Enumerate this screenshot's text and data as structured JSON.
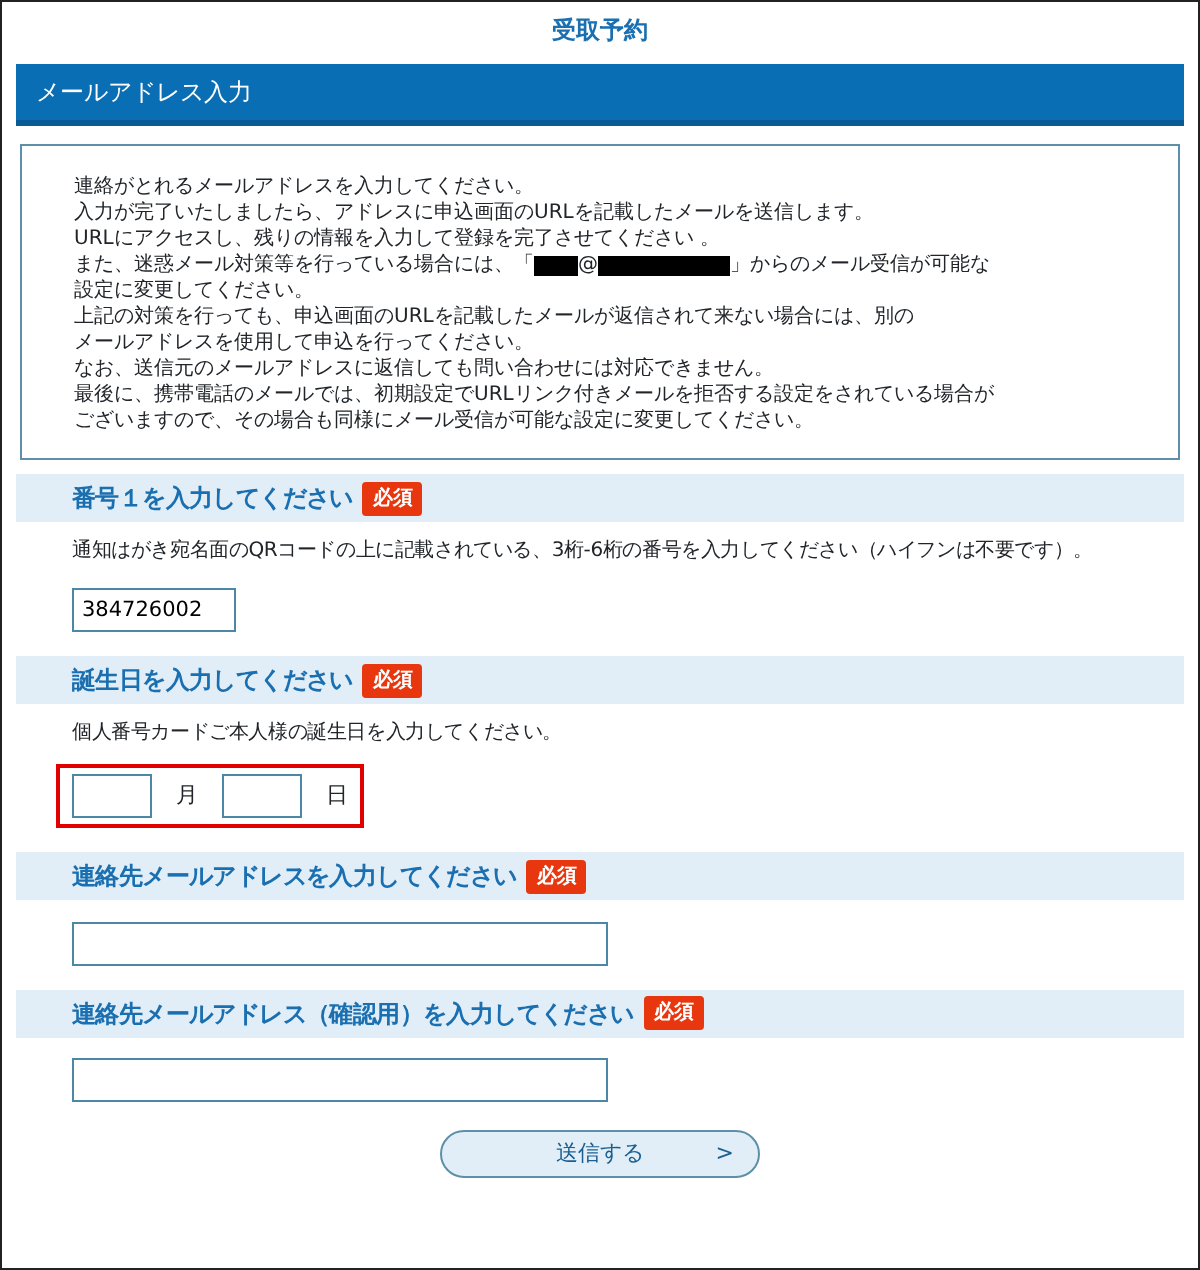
{
  "page_title": "受取予約",
  "section_header": "メールアドレス入力",
  "notice": {
    "lines": [
      {
        "kind": "text",
        "text": "連絡がとれるメールアドレスを入力してください。"
      },
      {
        "kind": "text",
        "text": "入力が完了いたしましたら、アドレスに申込画面のURLを記載したメールを送信します。"
      },
      {
        "kind": "text",
        "text": "URLにアクセスし、残りの情報を入力して登録を完了させてください 。"
      },
      {
        "kind": "redacted",
        "before": "また、迷惑メール対策等を行っている場合には、「",
        "at": "@",
        "after": "」からのメール受信が可能な"
      },
      {
        "kind": "text",
        "text": "設定に変更してください。"
      },
      {
        "kind": "text",
        "text": "上記の対策を行っても、申込画面のURLを記載したメールが返信されて来ない場合には、別の"
      },
      {
        "kind": "text",
        "text": "メールアドレスを使用して申込を行ってください。"
      },
      {
        "kind": "text",
        "text": "なお、送信元のメールアドレスに返信しても問い合わせには対応できません。"
      },
      {
        "kind": "text",
        "text": "最後に、携帯電話のメールでは、初期設定でURLリンク付きメールを拒否する設定をされている場合が"
      },
      {
        "kind": "text",
        "text": "ございますので、その場合も同様にメール受信が可能な設定に変更してください。"
      }
    ]
  },
  "fields": [
    {
      "kind": "short_text",
      "title": "番号１を入力してください",
      "required": "必須",
      "hint": "通知はがき宛名面のQRコードの上に記載されている、3桁-6桁の番号を入力してください（ハイフンは不要です）。",
      "value": "384726002"
    },
    {
      "kind": "monthday",
      "title": "誕生日を入力してください",
      "required": "必須",
      "hint": "個人番号カードご本人様の誕生日を入力してください。",
      "month_unit": "月",
      "day_unit": "日",
      "highlighted": true
    },
    {
      "kind": "text",
      "title": "連絡先メールアドレスを入力してください",
      "required": "必須"
    },
    {
      "kind": "text",
      "title": "連絡先メールアドレス（確認用）を入力してください",
      "required": "必須"
    }
  ],
  "submit": {
    "label": "送信する",
    "arrow": ">"
  }
}
